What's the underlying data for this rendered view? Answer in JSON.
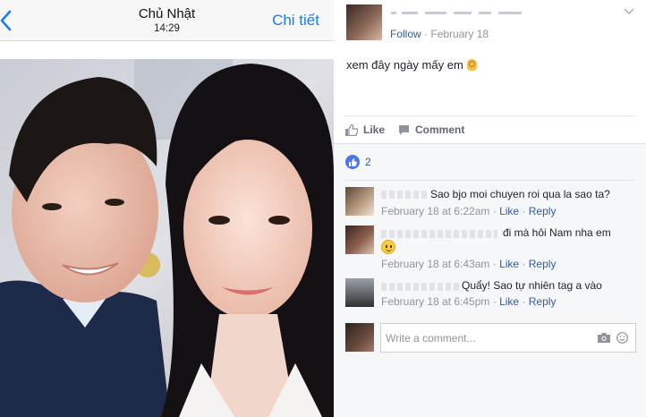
{
  "ios_viewer": {
    "title": "Chủ Nhật",
    "time": "14:29",
    "detail_label": "Chi tiết",
    "accent_color": "#1a7cf2"
  },
  "post": {
    "follow_label": "Follow",
    "separator": " · ",
    "date": "February 18",
    "text": "xem đây ngày mấy em",
    "text_emoji": "ok-hand-emoji"
  },
  "actions": {
    "like_label": "Like",
    "comment_label": "Comment"
  },
  "reactions": {
    "count": "2"
  },
  "comments": [
    {
      "text": "Sao bjo moi chuyen roi qua la sao ta?",
      "time": "February 18 at 6:22am",
      "like_label": "Like",
      "reply_label": "Reply"
    },
    {
      "text": "đi mà hôi Nam nha em",
      "time": "February 18 at 6:43am",
      "like_label": "Like",
      "reply_label": "Reply"
    },
    {
      "text": "Quẩy! Sao tự nhiên tag a vào",
      "time": "February 18 at 6:45pm",
      "like_label": "Like",
      "reply_label": "Reply"
    }
  ],
  "composer": {
    "placeholder": "Write a comment..."
  },
  "colors": {
    "link": "#365899",
    "meta": "#90949c",
    "comments_bg": "#f6f7f9",
    "like_badge": "#4a76e8"
  }
}
